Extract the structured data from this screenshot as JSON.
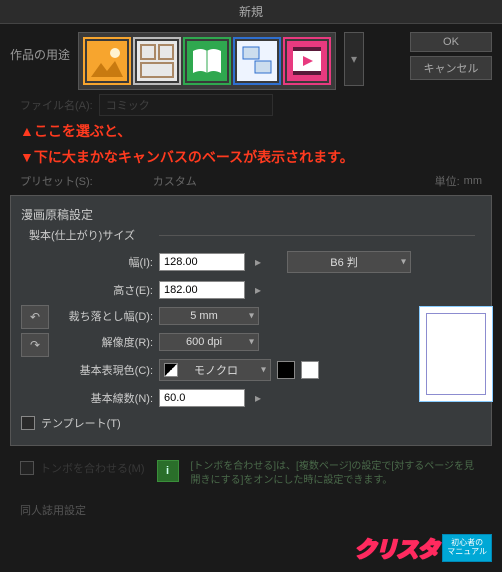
{
  "window_title": "新規",
  "purpose_label": "作品の用途",
  "buttons": {
    "ok": "OK",
    "cancel": "キャンセル"
  },
  "filename": {
    "label": "ファイル名(A):",
    "value": "コミック"
  },
  "annotation": {
    "line1": "▲ここを選ぶと、",
    "line2": "▼下に大まかなキャンバスのベースが表示されます。"
  },
  "preset": {
    "label": "プリセット(S):",
    "value": "カスタム",
    "unit_label": "単位:",
    "unit_value": "mm"
  },
  "panel": {
    "title": "漫画原稿設定",
    "fieldset": "製本(仕上がり)サイズ",
    "width_label": "幅(I):",
    "width_value": "128.00",
    "height_label": "高さ(E):",
    "height_value": "182.00",
    "size_preset": "B6 判",
    "bleed_label": "裁ち落とし幅(D):",
    "bleed_value": "5 mm",
    "resolution_label": "解像度(R):",
    "resolution_value": "600 dpi",
    "basic_color_label": "基本表現色(C):",
    "basic_color_value": "モノクロ",
    "basic_lines_label": "基本線数(N):",
    "basic_lines_value": "60.0",
    "template_label": "テンプレート(T)"
  },
  "below": {
    "crop_label": "トンボを合わせる(M)",
    "info_text": "[トンボを合わせる]は、[複数ページ]の設定で[対するページを見開きにする]をオンにした時に設定できます。",
    "section": "同人誌用設定"
  },
  "logo": {
    "main": "クリスタ",
    "badge_l1": "初心者の",
    "badge_l2": "マニュアル"
  },
  "colors": {
    "accent_orange": "#f7a52e",
    "accent_green": "#2fa84f",
    "accent_blue": "#2f6fcf",
    "accent_pink": "#e83a7f",
    "annotation": "#ff3a1f"
  }
}
